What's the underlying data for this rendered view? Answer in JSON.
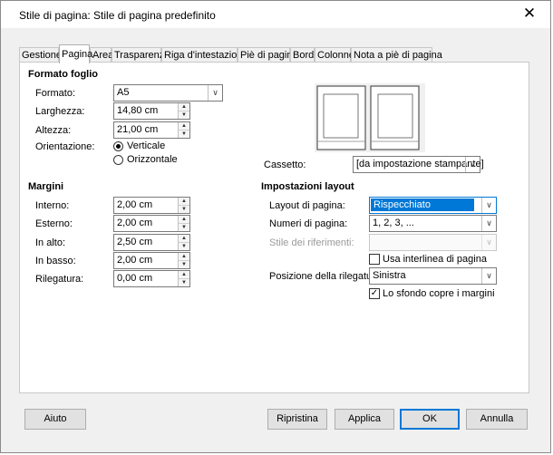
{
  "window": {
    "title": "Stile di pagina: Stile di pagina predefinito"
  },
  "tabs": [
    "Gestione",
    "Pagina",
    "Area",
    "Trasparenza",
    "Riga d'intestazione",
    "Piè di pagina",
    "Bordi",
    "Colonne",
    "Nota a piè di pagina"
  ],
  "active_tab": "Pagina",
  "paper": {
    "heading": "Formato foglio",
    "format_label": "Formato:",
    "format_value": "A5",
    "width_label": "Larghezza:",
    "width_value": "14,80 cm",
    "height_label": "Altezza:",
    "height_value": "21,00 cm",
    "orientation_label": "Orientazione:",
    "portrait_label": "Verticale",
    "landscape_label": "Orizzontale",
    "orientation_selected": "Verticale",
    "tray_label": "Cassetto:",
    "tray_value": "[da impostazione stampante]"
  },
  "margins": {
    "heading": "Margini",
    "inner_label": "Interno:",
    "inner_value": "2,00 cm",
    "outer_label": "Esterno:",
    "outer_value": "2,00 cm",
    "top_label": "In alto:",
    "top_value": "2,50 cm",
    "bottom_label": "In basso:",
    "bottom_value": "2,00 cm",
    "gutter_label": "Rilegatura:",
    "gutter_value": "0,00 cm"
  },
  "layout": {
    "heading": "Impostazioni layout",
    "page_layout_label": "Layout di pagina:",
    "page_layout_value": "Rispecchiato",
    "page_numbers_label": "Numeri di pagina:",
    "page_numbers_value": "1, 2, 3, ...",
    "ref_style_label": "Stile dei riferimenti:",
    "ref_style_value": "",
    "register_label": "Usa interlinea di pagina",
    "register_checked": false,
    "gutter_pos_label": "Posizione della rilegatura:",
    "gutter_pos_value": "Sinistra",
    "background_label": "Lo sfondo copre i margini",
    "background_checked": true
  },
  "buttons": {
    "help": "Aiuto",
    "reset": "Ripristina",
    "apply": "Applica",
    "ok": "OK",
    "cancel": "Annulla"
  },
  "colors": {
    "accent": "#0078d7",
    "panel_bg": "#ffffff",
    "dialog_bg": "#f0f0f0"
  }
}
